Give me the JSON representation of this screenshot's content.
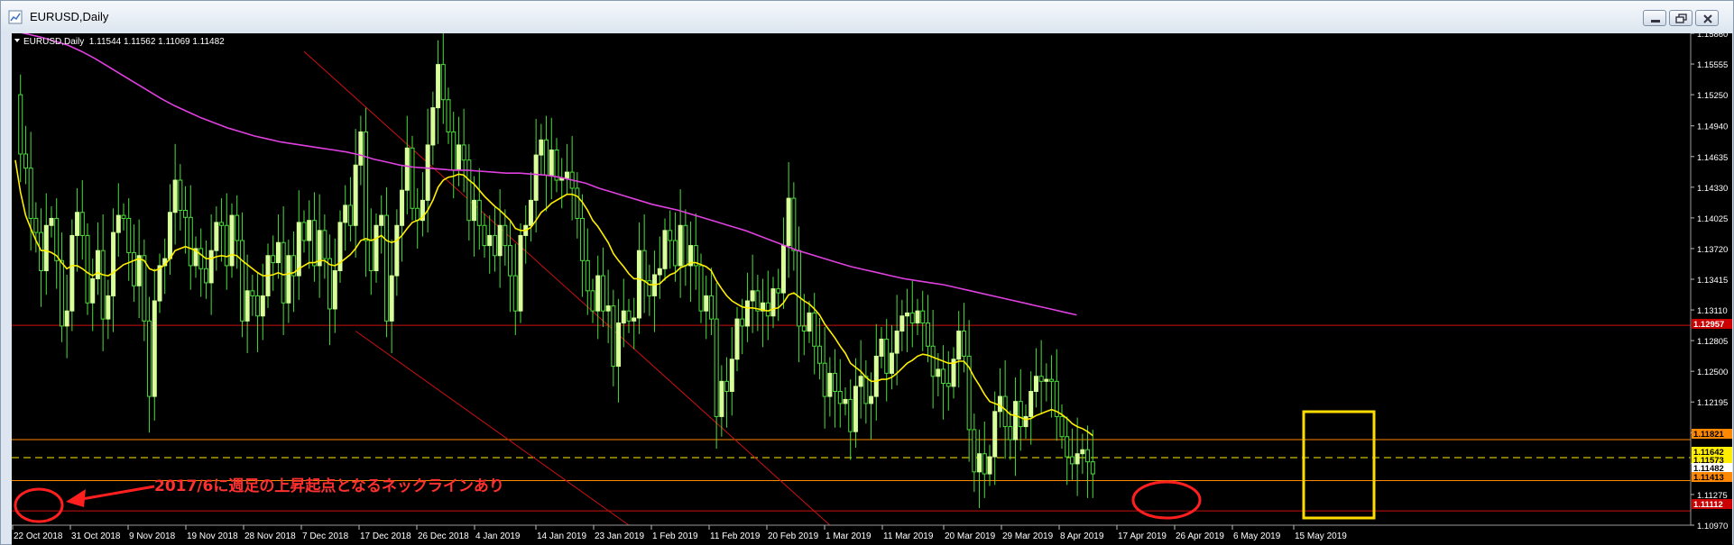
{
  "window": {
    "title": "EURUSD,Daily",
    "controls": [
      "minimize",
      "restore",
      "close"
    ]
  },
  "chart": {
    "header": "EURUSD,Daily  1.11544 1.11562 1.11069 1.11482",
    "symbol": "EURUSD",
    "timeframe": "Daily",
    "annotation": "2017/6に週足の上昇起点となるネックラインあり",
    "colors": {
      "background": "#000000",
      "axis_text": "#ffffff",
      "bull_candle": "#d8ff9a",
      "bear_wick": "#4ade3a",
      "ma_fast": "#ffee00",
      "ma_slow": "#e040e0",
      "channel": "#cc1111",
      "horizontal_red": "#cc1111",
      "horizontal_orange": "#ff8800",
      "highlight_box": "#ffdd00",
      "annotation_text": "#ff3030"
    },
    "price_labels": [
      {
        "value": "1.12957",
        "bg": "#cc0000",
        "fg": "#ffffff"
      },
      {
        "value": "1.11821",
        "bg": "#ff8800",
        "fg": "#000000"
      },
      {
        "value": "1.11642",
        "bg": "#ffee00",
        "fg": "#000000"
      },
      {
        "value": "1.11573",
        "bg": "#ffee00",
        "fg": "#000000"
      },
      {
        "value": "1.11482",
        "bg": "#ffffff",
        "fg": "#000000"
      },
      {
        "value": "1.11413",
        "bg": "#ff8800",
        "fg": "#000000"
      },
      {
        "value": "1.11112",
        "bg": "#cc0000",
        "fg": "#ffffff"
      }
    ]
  },
  "chart_data": {
    "type": "candlestick",
    "title": "EURUSD,Daily",
    "ohlc_header": {
      "open": 1.11544,
      "high": 1.11562,
      "low": 1.11069,
      "close": 1.11482
    },
    "y_ticks": [
      "1.15860",
      "1.15555",
      "1.15250",
      "1.14940",
      "1.14635",
      "1.14330",
      "1.14025",
      "1.13720",
      "1.13415",
      "1.13110",
      "1.12805",
      "1.12500",
      "1.12195",
      "1.11890",
      "1.11585",
      "1.11275",
      "1.10970"
    ],
    "ylim": [
      1.1097,
      1.1586
    ],
    "x_ticks": [
      "22 Oct 2018",
      "31 Oct 2018",
      "9 Nov 2018",
      "19 Nov 2018",
      "28 Nov 2018",
      "7 Dec 2018",
      "17 Dec 2018",
      "26 Dec 2018",
      "4 Jan 2019",
      "14 Jan 2019",
      "23 Jan 2019",
      "1 Feb 2019",
      "11 Feb 2019",
      "20 Feb 2019",
      "1 Mar 2019",
      "11 Mar 2019",
      "20 Mar 2019",
      "29 Mar 2019",
      "8 Apr 2019",
      "17 Apr 2019",
      "26 Apr 2019",
      "6 May 2019",
      "15 May 2019"
    ],
    "close_series": [
      1.1525,
      1.1466,
      1.1452,
      1.1402,
      1.1388,
      1.135,
      1.1395,
      1.1402,
      1.136,
      1.1295,
      1.131,
      1.1385,
      1.1408,
      1.1385,
      1.1318,
      1.1342,
      1.137,
      1.1302,
      1.1325,
      1.1388,
      1.1405,
      1.1402,
      1.1368,
      1.1335,
      1.1365,
      1.13,
      1.1225,
      1.132,
      1.1355,
      1.1362,
      1.1408,
      1.144,
      1.141,
      1.1403,
      1.1355,
      1.1372,
      1.1352,
      1.1338,
      1.137,
      1.1398,
      1.1395,
      1.1355,
      1.1405,
      1.138,
      1.13,
      1.133,
      1.1325,
      1.1305,
      1.1325,
      1.1365,
      1.1358,
      1.1378,
      1.1318,
      1.1365,
      1.1345,
      1.1398,
      1.138,
      1.14,
      1.1355,
      1.139,
      1.1362,
      1.1312,
      1.135,
      1.1398,
      1.1415,
      1.1395,
      1.1455,
      1.1488,
      1.138,
      1.135,
      1.1395,
      1.1405,
      1.13,
      1.1345,
      1.1395,
      1.143,
      1.1472,
      1.1412,
      1.14,
      1.142,
      1.1475,
      1.1512,
      1.1555,
      1.152,
      1.1488,
      1.145,
      1.1475,
      1.146,
      1.14,
      1.142,
      1.1395,
      1.1375,
      1.1385,
      1.1365,
      1.1395,
      1.1375,
      1.1345,
      1.131,
      1.1385,
      1.1395,
      1.142,
      1.1465,
      1.148,
      1.1445,
      1.147,
      1.144,
      1.1442,
      1.1448,
      1.1432,
      1.1402,
      1.136,
      1.133,
      1.131,
      1.1345,
      1.131,
      1.1315,
      1.1255,
      1.1298,
      1.131,
      1.13,
      1.1303,
      1.137,
      1.134,
      1.1325,
      1.1346,
      1.1352,
      1.139,
      1.138,
      1.1355,
      1.1395,
      1.1355,
      1.1375,
      1.1355,
      1.131,
      1.1325,
      1.1302,
      1.1205,
      1.124,
      1.123,
      1.1262,
      1.1302,
      1.1295,
      1.132,
      1.133,
      1.131,
      1.1318,
      1.1305,
      1.1332,
      1.1328,
      1.1375,
      1.1422,
      1.137,
      1.1295,
      1.129,
      1.1308,
      1.1275,
      1.1258,
      1.1225,
      1.1248,
      1.123,
      1.1218,
      1.1222,
      1.119,
      1.1235,
      1.1245,
      1.1218,
      1.1225,
      1.1265,
      1.1282,
      1.1248,
      1.1268,
      1.129,
      1.1305,
      1.1308,
      1.1298,
      1.131,
      1.1298,
      1.1275,
      1.1245,
      1.1252,
      1.1238,
      1.1235,
      1.1262,
      1.129,
      1.1265,
      1.1192,
      1.115,
      1.1168,
      1.1148,
      1.1165,
      1.121,
      1.1225,
      1.1195,
      1.1182,
      1.122,
      1.1195,
      1.1205,
      1.123,
      1.1245,
      1.124,
      1.1242,
      1.124,
      1.1205,
      1.1185,
      1.1165,
      1.1158,
      1.1168,
      1.1172,
      1.116,
      1.1148
    ],
    "ma_fast_series": [
      1.146,
      1.1428,
      1.1405,
      1.1392,
      1.138,
      1.137,
      1.137,
      1.1368,
      1.1365,
      1.1358,
      1.1352,
      1.1355,
      1.1355,
      1.1352,
      1.1348,
      1.1345,
      1.1348,
      1.1346,
      1.1345,
      1.1348,
      1.1352,
      1.1356,
      1.1358,
      1.136,
      1.1362,
      1.136,
      1.1352,
      1.135,
      1.1352,
      1.1356,
      1.1362,
      1.137,
      1.1372,
      1.1374,
      1.1372,
      1.137,
      1.1366,
      1.1362,
      1.1362,
      1.1364,
      1.1365,
      1.1364,
      1.1366,
      1.1365,
      1.136,
      1.1356,
      1.1352,
      1.1348,
      1.1345,
      1.1345,
      1.1346,
      1.1348,
      1.1346,
      1.1347,
      1.1348,
      1.1352,
      1.1355,
      1.1358,
      1.1358,
      1.136,
      1.136,
      1.1356,
      1.1355,
      1.1358,
      1.1362,
      1.1366,
      1.1372,
      1.138,
      1.1382,
      1.138,
      1.1382,
      1.1385,
      1.138,
      1.1378,
      1.138,
      1.1385,
      1.1392,
      1.1398,
      1.14,
      1.1403,
      1.141,
      1.142,
      1.1433,
      1.144,
      1.1443,
      1.1444,
      1.1446,
      1.1445,
      1.144,
      1.1436,
      1.143,
      1.1424,
      1.1419,
      1.1414,
      1.141,
      1.1405,
      1.14,
      1.1392,
      1.139,
      1.139,
      1.1393,
      1.14,
      1.1408,
      1.1412,
      1.1417,
      1.142,
      1.1423,
      1.1426,
      1.1426,
      1.1424,
      1.1418,
      1.141,
      1.14,
      1.1394,
      1.1386,
      1.1378,
      1.1367,
      1.136,
      1.1354,
      1.1347,
      1.1342,
      1.1342,
      1.134,
      1.1336,
      1.1336,
      1.1337,
      1.1342,
      1.1346,
      1.1348,
      1.1353,
      1.1355,
      1.1358,
      1.1358,
      1.1356,
      1.1354,
      1.135,
      1.134,
      1.1332,
      1.1325,
      1.132,
      1.1317,
      1.1314,
      1.1313,
      1.1313,
      1.1312,
      1.1311,
      1.131,
      1.1312,
      1.1313,
      1.1318,
      1.1326,
      1.1328,
      1.1324,
      1.132,
      1.1317,
      1.1312,
      1.1306,
      1.1297,
      1.129,
      1.1283,
      1.1275,
      1.1268,
      1.1258,
      1.1254,
      1.125,
      1.1244,
      1.124,
      1.124,
      1.1242,
      1.1242,
      1.1244,
      1.1248,
      1.1253,
      1.1258,
      1.1261,
      1.1265,
      1.1267,
      1.1266,
      1.1264,
      1.1262,
      1.126,
      1.1258,
      1.1258,
      1.126,
      1.126,
      1.1254,
      1.1244,
      1.1236,
      1.1227,
      1.122,
      1.1218,
      1.1216,
      1.1212,
      1.1207,
      1.1206,
      1.1204,
      1.1202,
      1.1203,
      1.1206,
      1.1208,
      1.121,
      1.1212,
      1.121,
      1.1207,
      1.1203,
      1.1198,
      1.1195,
      1.1193,
      1.119,
      1.1186
    ],
    "ma_slow_series": [
      1.1588,
      1.1585,
      1.1582,
      1.1578,
      1.1574,
      1.1568,
      1.1561,
      1.1553,
      1.1545,
      1.1537,
      1.1529,
      1.1521,
      1.1514,
      1.1508,
      1.1502,
      1.1497,
      1.1492,
      1.1488,
      1.1484,
      1.1481,
      1.1478,
      1.1476,
      1.1474,
      1.1472,
      1.147,
      1.1468,
      1.1465,
      1.1461,
      1.1458,
      1.1455,
      1.1453,
      1.1452,
      1.1451,
      1.145,
      1.145,
      1.1449,
      1.1448,
      1.1447,
      1.1447,
      1.1446,
      1.1445,
      1.1443,
      1.144,
      1.1437,
      1.1432,
      1.1428,
      1.1424,
      1.142,
      1.1416,
      1.1413,
      1.141,
      1.1406,
      1.1402,
      1.1398,
      1.1394,
      1.139,
      1.1385,
      1.138,
      1.1375,
      1.137,
      1.1366,
      1.1362,
      1.1358,
      1.1354,
      1.1351,
      1.1348,
      1.1345,
      1.1342,
      1.134,
      1.1338,
      1.1336,
      1.1333,
      1.133,
      1.1327,
      1.1324,
      1.1321,
      1.1318,
      1.1315,
      1.1312,
      1.1309,
      1.1306
    ],
    "channel_upper": {
      "from": {
        "date": "9 Jan 2019",
        "price": 1.1568
      },
      "to": {
        "date": "31 May 2019",
        "price": 1.1097
      }
    },
    "channel_lower": {
      "from": {
        "date": "23 Jan 2019",
        "price": 1.129
      },
      "to": {
        "date": "6 Apr 2019",
        "price": 1.1097
      }
    },
    "horizontal_lines": [
      {
        "price": 1.12957,
        "style": "solid",
        "color": "red"
      },
      {
        "price": 1.11821,
        "style": "solid",
        "color": "orange"
      },
      {
        "price": 1.11642,
        "style": "dashed",
        "color": "yellow"
      },
      {
        "price": 1.11413,
        "style": "solid",
        "color": "orange"
      },
      {
        "price": 1.11112,
        "style": "solid",
        "color": "red"
      }
    ],
    "highlight_box": {
      "from_date": "15 May 2019",
      "to_date": "22 May 2019",
      "price_high": 1.12055,
      "price_low": 1.11012
    }
  }
}
